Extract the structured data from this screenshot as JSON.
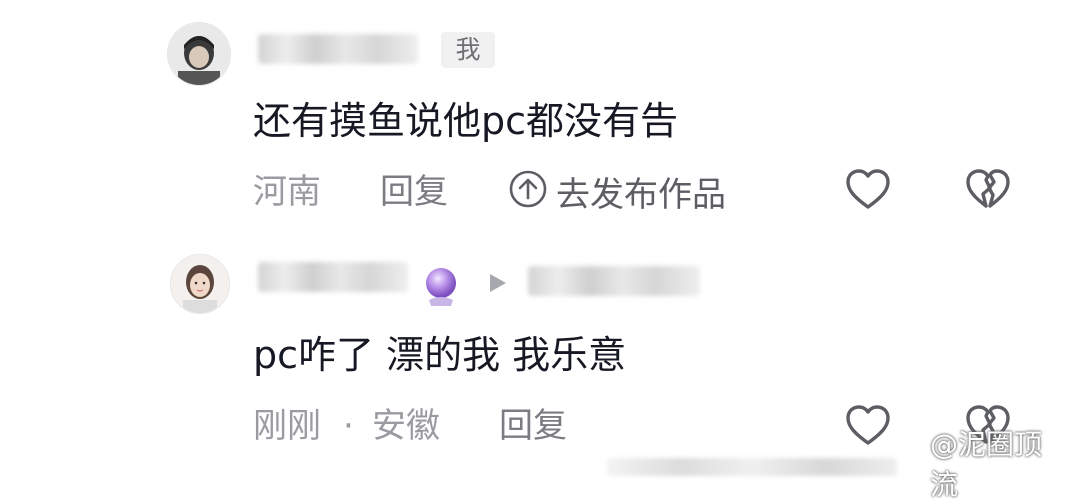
{
  "comments": [
    {
      "author_tag": "我",
      "text": "还有摸鱼说他pc都没有告",
      "location": "河南",
      "reply_label": "回复",
      "publish_label": "去发布作品"
    },
    {
      "text": "pc咋了  漂的我 我乐意",
      "time": "刚刚",
      "separator": "·",
      "location": "安徽",
      "reply_label": "回复"
    }
  ],
  "watermark": {
    "text": "@泥圈顶流"
  },
  "icons": [
    "like-heart-icon",
    "dislike-broken-heart-icon",
    "publish-arrow-icon",
    "crystal-ball-icon",
    "reply-arrow-icon",
    "weibo-icon"
  ]
}
